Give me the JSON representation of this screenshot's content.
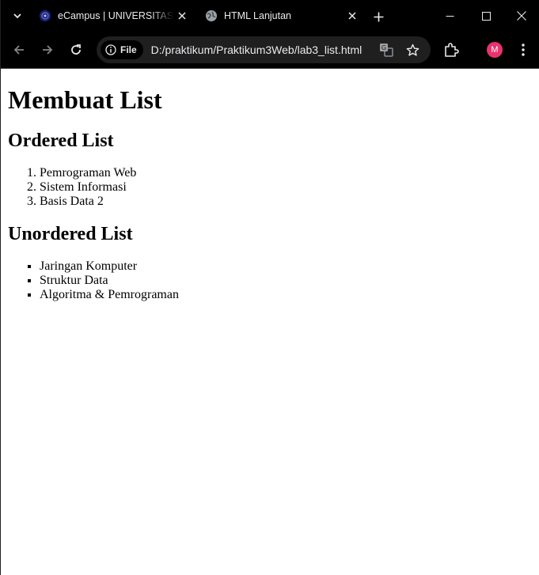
{
  "browser": {
    "tabs": [
      {
        "title": "eCampus | UNIVERSITAS P",
        "icon": "university-logo-icon"
      },
      {
        "title": "HTML Lanjutan",
        "icon": "globe-icon"
      }
    ],
    "address_chip": "File",
    "url": "D:/praktikum/Praktikum3Web/lab3_list.html",
    "profile_initial": "M",
    "profile_color": "#e8336d"
  },
  "page": {
    "title": "Membuat List",
    "ordered_heading": "Ordered List",
    "ordered_items": [
      "Pemrograman Web",
      "Sistem Informasi",
      "Basis Data 2"
    ],
    "unordered_heading": "Unordered List",
    "unordered_items": [
      "Jaringan Komputer",
      "Struktur Data",
      "Algoritma & Pemrograman"
    ]
  }
}
